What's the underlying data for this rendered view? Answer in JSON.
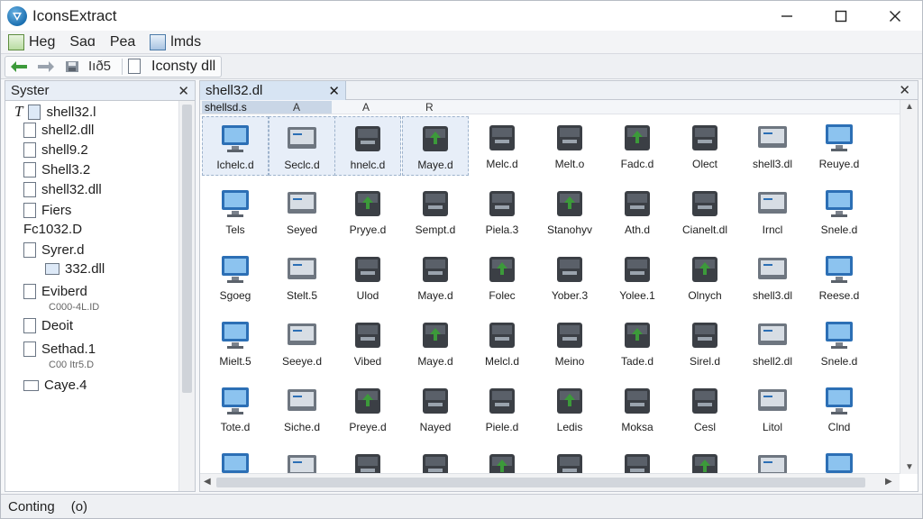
{
  "window": {
    "title": "IconsExtract"
  },
  "menu": [
    {
      "label": "Heg",
      "icon": "file-icon"
    },
    {
      "label": "Saɑ",
      "icon": "none"
    },
    {
      "label": "Pea",
      "icon": "none"
    },
    {
      "label": "lmds",
      "icon": "image-icon"
    }
  ],
  "toolbar": {
    "pages_label": "Iıð5",
    "file_label": "Iconsty dll"
  },
  "left_panel": {
    "title": "Syster",
    "items": [
      {
        "label": "shell32.l",
        "prefix": "T",
        "sub": ""
      },
      {
        "label": "shell2.dll",
        "prefix": "",
        "sub": ""
      },
      {
        "label": "shell9.2",
        "prefix": "",
        "sub": ""
      },
      {
        "label": "Shell3.2",
        "prefix": "",
        "sub": ""
      },
      {
        "label": "shell32.dll",
        "prefix": "",
        "sub": ""
      },
      {
        "label": "Fiers",
        "prefix": "",
        "sub": ""
      },
      {
        "label": "Fc1032.D",
        "prefix": "",
        "sub": ""
      },
      {
        "label": "Syrer.d",
        "prefix": "",
        "sub": ""
      },
      {
        "label": "332.dll",
        "prefix": "",
        "sub": ""
      },
      {
        "label": "Eviberd",
        "prefix": "",
        "sub": "C000-4L.ID"
      },
      {
        "label": "Deoit",
        "prefix": "",
        "sub": ""
      },
      {
        "label": "Sethad.1",
        "prefix": "",
        "sub": "C00 Itr5.D"
      },
      {
        "label": "Caye.4",
        "prefix": "",
        "sub": ""
      }
    ]
  },
  "right_panel": {
    "tab_label": "shell32.dl",
    "columns": [
      "shellsd.s",
      "A",
      "A",
      "R"
    ],
    "rows": [
      [
        "Ichelc.d",
        "Seclc.d",
        "hnelc.d",
        "Maye.d",
        "Melc.d",
        "Melt.o",
        "Fadc.d",
        "Olect",
        "shell3.dl",
        "Reuye.d"
      ],
      [
        "Tels",
        "Seyed",
        "Pryye.d",
        "Sempt.d",
        "Piela.3",
        "Stanohyv",
        "Ath.d",
        "Cianelt.dl",
        "Irncl",
        "Snele.d"
      ],
      [
        "Sgoeg",
        "Stelt.5",
        "Ulod",
        "Maye.d",
        "Folec",
        "Yober.3",
        "Yolee.1",
        "Olnych",
        "shell3.dl",
        "Reese.d"
      ],
      [
        "Mielt.5",
        "Seeye.d",
        "Vibed",
        "Maye.d",
        "Melcl.d",
        "Meino",
        "Tade.d",
        "Sirel.d",
        "shell2.dl",
        "Snele.d"
      ],
      [
        "Tote.d",
        "Siche.d",
        "Preye.d",
        "Nayed",
        "Piele.d",
        "Ledis",
        "Moksa",
        "Cesl",
        "Litol",
        "Clnd"
      ],
      [
        "",
        "",
        "",
        "",
        "",
        "",
        "",
        "",
        "",
        ""
      ]
    ],
    "selected_cells": [
      0,
      1,
      2,
      3
    ]
  },
  "status": {
    "text": "Conting",
    "extra": "(o)"
  },
  "colors": {
    "accent": "#1b6fb0",
    "selection": "#d7e4f3",
    "icon_dark": "#3b3f45",
    "icon_green": "#3c9a3a"
  }
}
